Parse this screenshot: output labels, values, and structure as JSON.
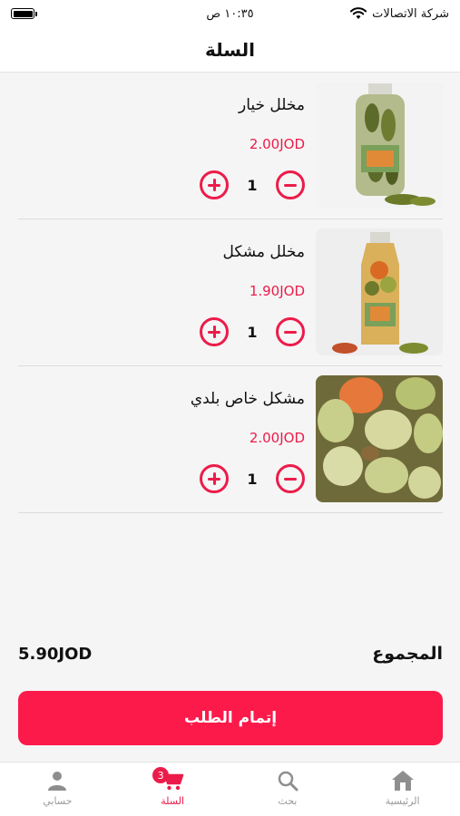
{
  "status_bar": {
    "carrier": "شركة الاتصالات",
    "time": "١٠:٣٥ ص"
  },
  "header": {
    "title": "السلة"
  },
  "cart": {
    "items": [
      {
        "name": "مخلل خيار",
        "price": "2.00JOD",
        "quantity": "1",
        "image_icon": "pickled-cucumber-jar"
      },
      {
        "name": "مخلل مشكل",
        "price": "1.90JOD",
        "quantity": "1",
        "image_icon": "mixed-pickles-jar"
      },
      {
        "name": "مشكل خاص بلدي",
        "price": "2.00JOD",
        "quantity": "1",
        "image_icon": "mixed-pickles-closeup"
      }
    ]
  },
  "summary": {
    "total_label": "المجموع",
    "total_value": "5.90JOD"
  },
  "checkout": {
    "label": "إتمام الطلب"
  },
  "tab_bar": {
    "tabs": [
      {
        "label": "حسابي",
        "icon": "person-icon"
      },
      {
        "label": "السلة",
        "icon": "cart-icon",
        "badge": "3",
        "active": true
      },
      {
        "label": "بحث",
        "icon": "search-icon"
      },
      {
        "label": "الرئيسية",
        "icon": "home-icon"
      }
    ]
  },
  "colors": {
    "accent": "#ec1c4a",
    "button": "#fc1a4b",
    "background": "#f5f5f5"
  }
}
